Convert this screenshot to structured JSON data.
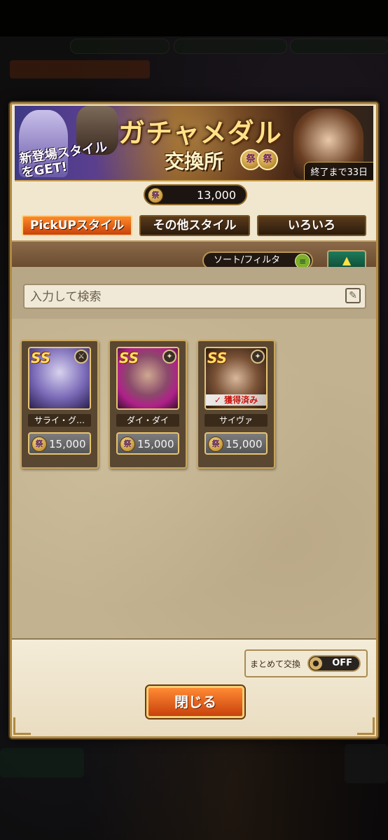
{
  "banner": {
    "title": "ガチャメダル",
    "subtitle": "交換所",
    "promo": "新登場スタイル\nをGET!",
    "deadline": "終了まで33日",
    "medal_glyph": "祭"
  },
  "currency": {
    "icon": "medal-icon",
    "coin_glyph": "祭",
    "amount": "13,000"
  },
  "tabs": [
    {
      "label": "PickUPスタイル",
      "active": true
    },
    {
      "label": "その他スタイル",
      "active": false
    },
    {
      "label": "いろいろ",
      "active": false
    }
  ],
  "filter": {
    "sort_label": "ソート/フィルタ",
    "search_placeholder": "入力して検索"
  },
  "items": [
    {
      "name": "サライ・グ…",
      "rank": "SS",
      "price": "15,000",
      "owned": false
    },
    {
      "name": "ダイ・ダイ",
      "rank": "SS",
      "price": "15,000",
      "owned": false
    },
    {
      "name": "サイヴァ",
      "rank": "SS",
      "price": "15,000",
      "owned": true,
      "owned_label": "獲得済み"
    }
  ],
  "bulk_exchange": {
    "label": "まとめて交換",
    "state": "OFF"
  },
  "close_label": "閉じる",
  "colors": {
    "accent_orange": "#e0621a",
    "panel": "#f1e7cf",
    "gold": "#c9a65d"
  }
}
